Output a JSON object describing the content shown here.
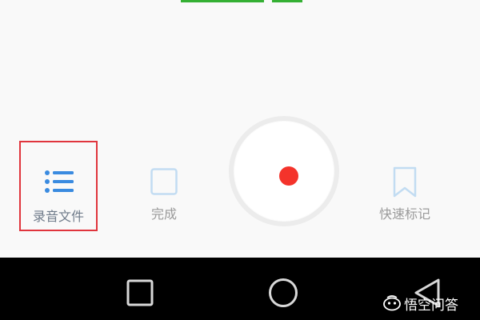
{
  "toolbar": {
    "recordings_label": "录音文件",
    "done_label": "完成",
    "mark_label": "快速标记"
  },
  "icons": {
    "recordings": "list-icon",
    "done": "square-check-icon",
    "mark": "bookmark-icon",
    "record": "record-dot-icon",
    "nav_recent": "square-icon",
    "nav_home": "circle-icon",
    "nav_back": "triangle-back-icon"
  },
  "watermark": {
    "text": "悟空问答"
  },
  "colors": {
    "accent_blue": "#3a8be0",
    "record_red": "#f4332b",
    "highlight_red": "#e0353d",
    "muted_blue": "#c2dcf2",
    "top_strip_green": "#35b034"
  }
}
